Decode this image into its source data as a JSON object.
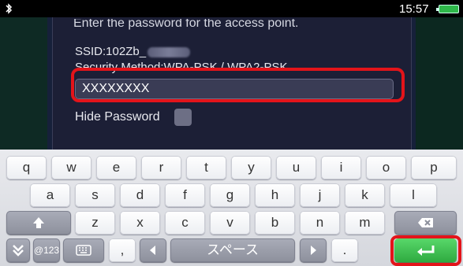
{
  "status": {
    "time": "15:57"
  },
  "dialog": {
    "instruction": "Enter the password for the access point.",
    "ssid_label": "SSID:102Zb_",
    "security_label": "Security Method:WPA-PSK / WPA2-PSK",
    "password_value": "XXXXXXXX",
    "hide_password_label": "Hide Password"
  },
  "keyboard": {
    "row1": [
      "q",
      "w",
      "e",
      "r",
      "t",
      "y",
      "u",
      "i",
      "o",
      "p"
    ],
    "row2": [
      "a",
      "s",
      "d",
      "f",
      "g",
      "h",
      "j",
      "k",
      "l"
    ],
    "row3": [
      "z",
      "x",
      "c",
      "v",
      "b",
      "n",
      "m"
    ],
    "mode_label": "@123",
    "comma": ",",
    "space_label": "スペース",
    "period": "."
  },
  "colors": {
    "highlight": "#e3141a",
    "enter": "#3cc04e",
    "battery": "#2fb84a"
  }
}
